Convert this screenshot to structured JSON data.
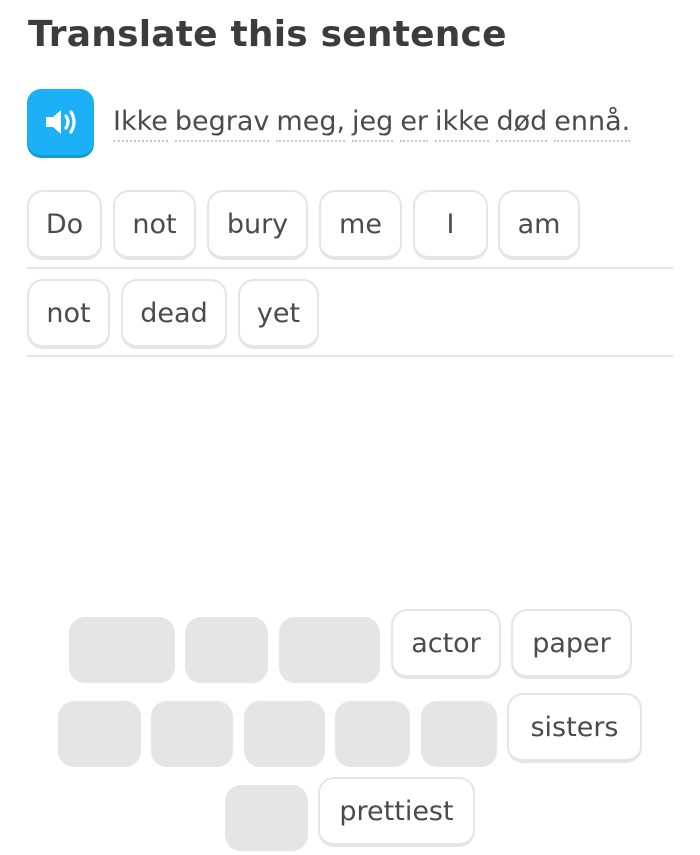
{
  "header": {
    "title": "Translate this sentence"
  },
  "prompt": {
    "speaker_icon": "speaker-icon",
    "words": [
      "Ikke",
      "begrav",
      "meg,",
      "jeg",
      "er",
      "ikke",
      "død",
      "ennå."
    ]
  },
  "answer": {
    "row1": [
      "Do",
      "not",
      "bury",
      "me",
      "I",
      "am"
    ],
    "row2": [
      "not",
      "dead",
      "yet"
    ]
  },
  "bank": {
    "available": [
      "actor",
      "paper",
      "sisters",
      "prettiest"
    ],
    "used_slot_count": 9
  },
  "colors": {
    "accent": "#1cb0f6",
    "chip_border": "#e5e5e5",
    "slot_fill": "#e5e5e5",
    "text": "#4b4b4b"
  }
}
